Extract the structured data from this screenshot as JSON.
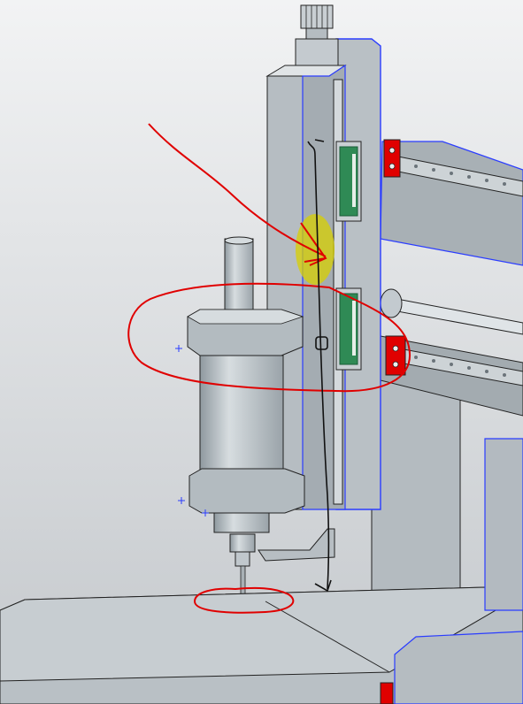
{
  "scene": {
    "type": "cad-viewport",
    "subject": "cnc-z-axis-spindle-assembly",
    "background_top": "#f2f3f4",
    "background_bottom": "#c4c8cc"
  },
  "colors": {
    "steel": "#bcc4c9",
    "steel_dark": "#8d979e",
    "steel_light": "#dde2e5",
    "edge": "#222222",
    "selection_edge": "#2a3cff",
    "rail_block": "#2f8a55",
    "end_block": "#e00000",
    "annotation_red": "#e00000",
    "annotation_black": "#111111",
    "highlight": "#d8d000"
  },
  "annotations": [
    {
      "kind": "arrow",
      "color": "red",
      "target": "z-carriage-plate"
    },
    {
      "kind": "ellipse",
      "color": "red",
      "target": "spindle-clamp-and-lower-rail-block"
    },
    {
      "kind": "ellipse",
      "color": "red",
      "target": "tool-tip-contact-point"
    },
    {
      "kind": "highlight",
      "color": "yellow",
      "target": "carriage-mounting-area"
    },
    {
      "kind": "arrow",
      "color": "black",
      "target": "z-travel-path"
    }
  ]
}
